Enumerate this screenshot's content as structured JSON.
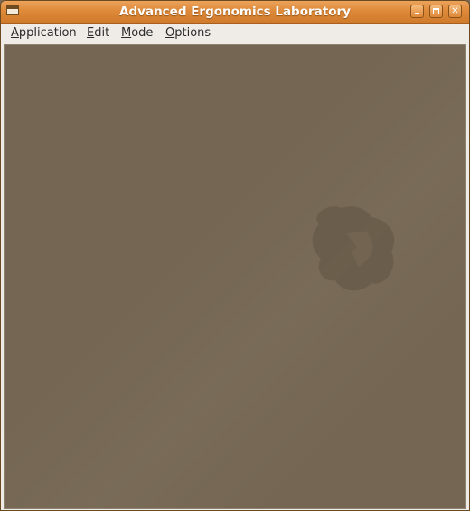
{
  "window": {
    "title": "Advanced Ergonomics Laboratory",
    "controls": {
      "minimize_icon": "minimize-icon",
      "maximize_icon": "maximize-icon",
      "close_icon": "close-icon",
      "close_glyph": "✕"
    }
  },
  "menubar": {
    "items": [
      {
        "accel": "A",
        "rest": "pplication"
      },
      {
        "accel": "E",
        "rest": "dit"
      },
      {
        "accel": "M",
        "rest": "ode"
      },
      {
        "accel": "O",
        "rest": "ptions"
      }
    ]
  },
  "canvas": {
    "background": "#746652",
    "watermark_icon": "ubuntu-tux-logo-icon"
  },
  "colors": {
    "titlebar_accent": "#df8a3a",
    "menubar_bg": "#efebe7"
  }
}
